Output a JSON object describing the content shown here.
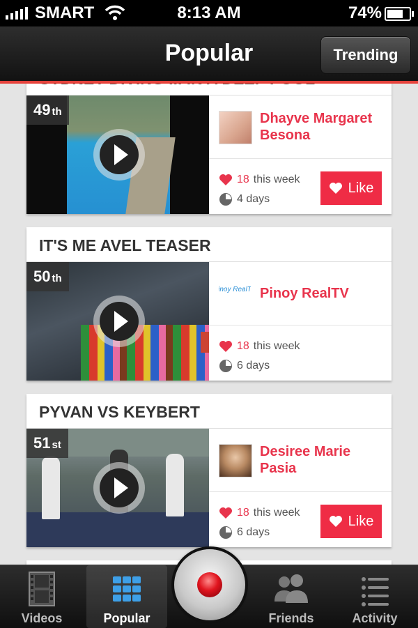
{
  "status": {
    "carrier": "SMART",
    "time": "8:13 AM",
    "battery": "74%"
  },
  "nav": {
    "title": "Popular",
    "trending": "Trending"
  },
  "videos": [
    {
      "title": "SYDNEY DIVING ... IN A DEEP POOL",
      "rank": "49",
      "rank_suffix": "th",
      "user": "Dhayve Margaret Besona",
      "likes": "18",
      "likes_text": "this week",
      "age": "4 days",
      "like_label": "Like"
    },
    {
      "title": "IT'S ME AVEL TEASER",
      "rank": "50",
      "rank_suffix": "th",
      "user": "Pinoy RealTV",
      "likes": "18",
      "likes_text": "this week",
      "age": "6 days",
      "avatar_text": "Pinoy RealTV"
    },
    {
      "title": "PYVAN VS KEYBERT",
      "rank": "51",
      "rank_suffix": "st",
      "user": "Desiree Marie Pasia",
      "likes": "18",
      "likes_text": "this week",
      "age": "6 days",
      "like_label": "Like"
    }
  ],
  "tabs": {
    "videos": "Videos",
    "popular": "Popular",
    "friends": "Friends",
    "activity": "Activity"
  },
  "colors": {
    "accent": "#ef2c45",
    "nav_line": "#e5433c"
  }
}
